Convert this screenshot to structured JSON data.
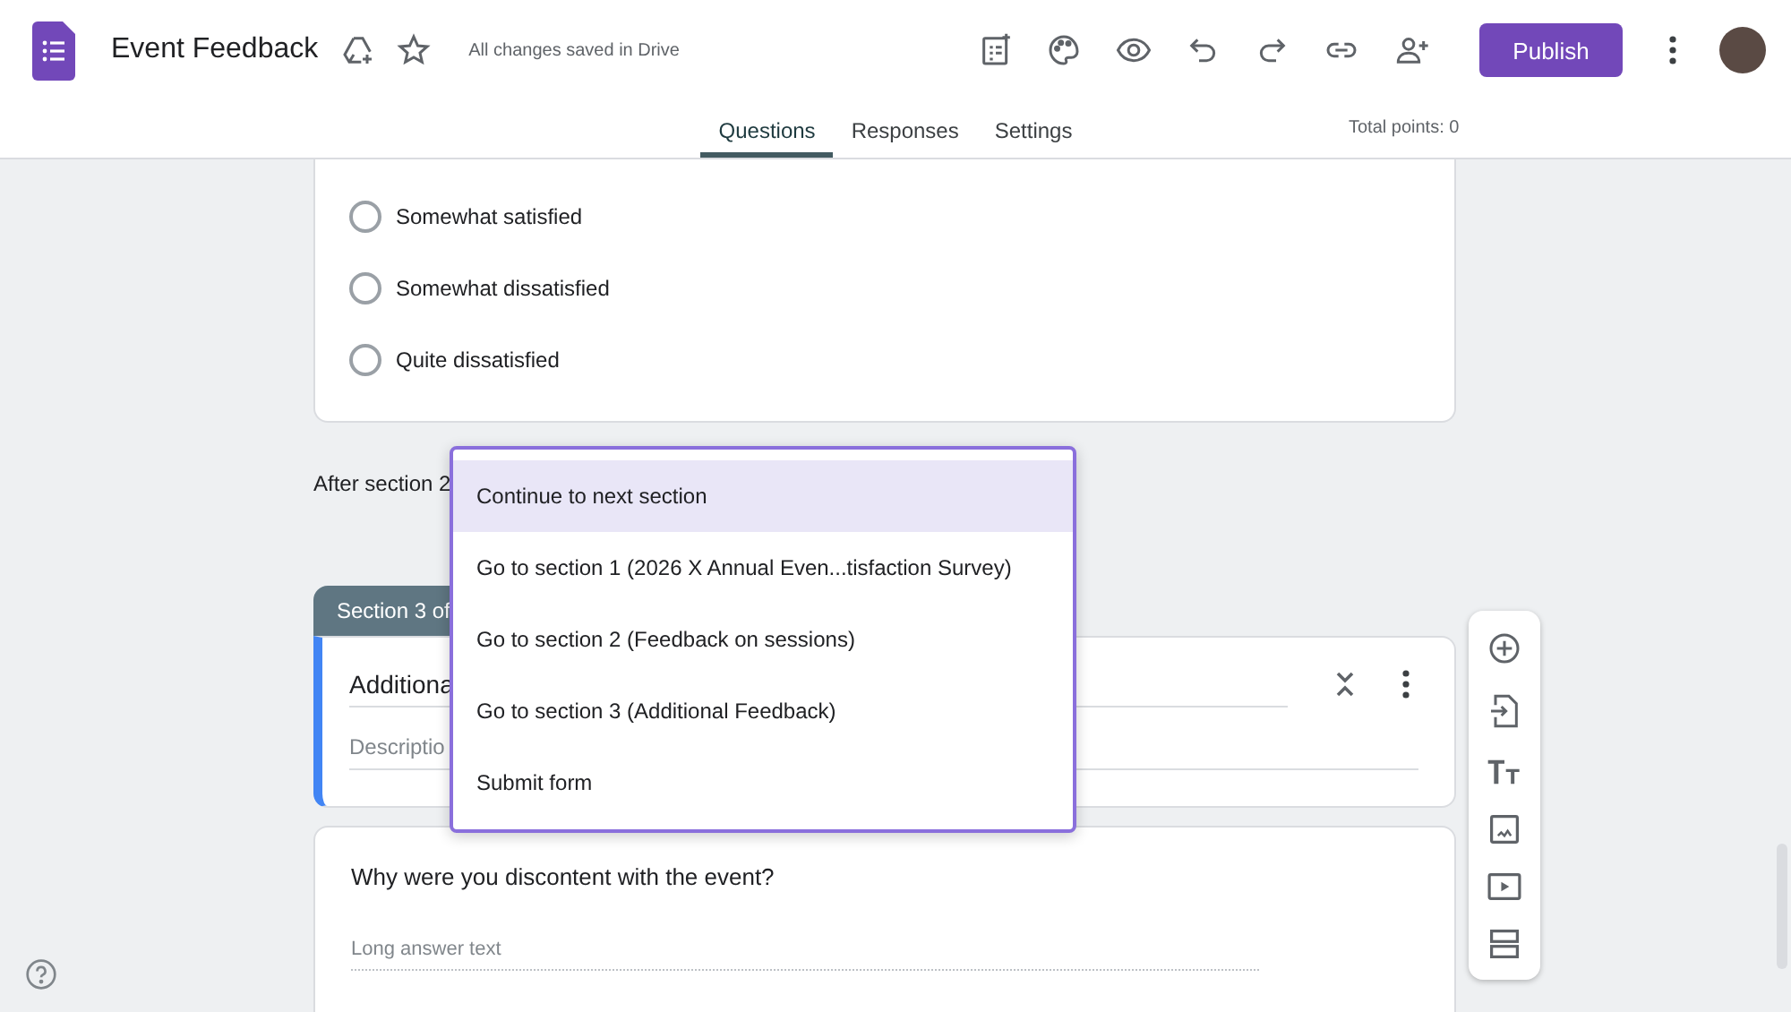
{
  "app": {
    "title": "Event Feedback",
    "save_status": "All changes saved in Drive",
    "publish_label": "Publish"
  },
  "tabs": [
    {
      "label": "Questions",
      "selected": true
    },
    {
      "label": "Responses",
      "selected": false
    },
    {
      "label": "Settings",
      "selected": false
    }
  ],
  "total_points": "Total points: 0",
  "question_card": {
    "options": [
      {
        "label": "Somewhat satisfied",
        "selected": false
      },
      {
        "label": "Somewhat dissatisfied",
        "selected": false
      },
      {
        "label": "Quite dissatisfied",
        "selected": false
      }
    ]
  },
  "after_section_label": "After section 2",
  "section": {
    "tab": "Section 3 of",
    "title": "Additiona",
    "description_placeholder": "Descriptio"
  },
  "question": {
    "title": "Why were you discontent with the event?",
    "placeholder": "Long answer text"
  },
  "dropdown_menu": {
    "items": [
      {
        "label": "Continue to next section",
        "selected": true
      },
      {
        "label": "Go to section 1 (2026 X Annual Even...tisfaction Survey)",
        "selected": false
      },
      {
        "label": "Go to section 2 (Feedback on sessions)",
        "selected": false
      },
      {
        "label": "Go to section 3 (Additional Feedback)",
        "selected": false
      },
      {
        "label": "Submit form",
        "selected": false
      }
    ]
  }
}
